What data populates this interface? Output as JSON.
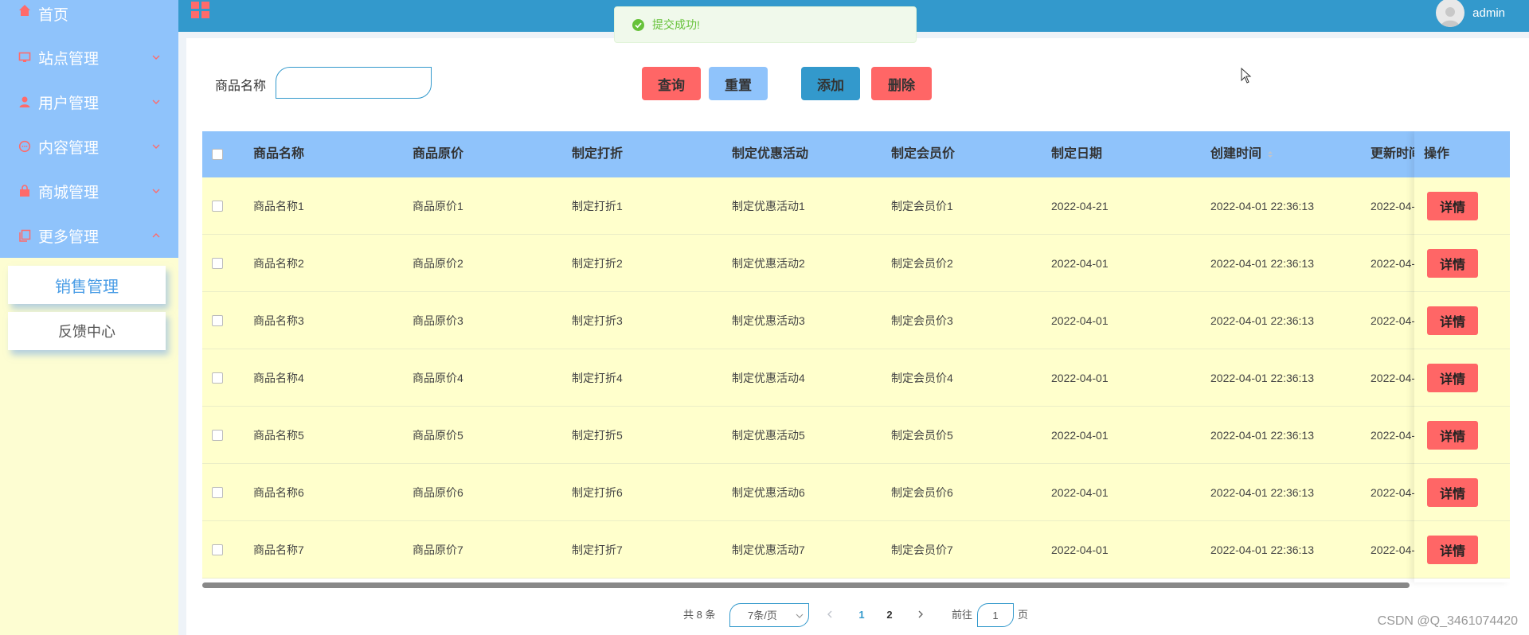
{
  "sidebar": {
    "items": [
      {
        "label": "首页",
        "icon": "home-icon"
      },
      {
        "label": "站点管理",
        "icon": "monitor-icon"
      },
      {
        "label": "用户管理",
        "icon": "user-icon"
      },
      {
        "label": "内容管理",
        "icon": "chat-icon"
      },
      {
        "label": "商城管理",
        "icon": "bag-icon"
      },
      {
        "label": "更多管理",
        "icon": "copy-icon"
      }
    ],
    "submenu": [
      {
        "label": "销售管理"
      },
      {
        "label": "反馈中心"
      }
    ]
  },
  "header": {
    "user_name": "admin"
  },
  "toast": {
    "message": "提交成功!"
  },
  "search": {
    "label": "商品名称",
    "value": "",
    "placeholder": ""
  },
  "toolbar": {
    "query_label": "查询",
    "reset_label": "重置",
    "add_label": "添加",
    "delete_label": "删除"
  },
  "table": {
    "columns": [
      "商品名称",
      "商品原价",
      "制定打折",
      "制定优惠活动",
      "制定会员价",
      "制定日期",
      "创建时间",
      "更新时间",
      "操作"
    ],
    "rows": [
      [
        "商品名称1",
        "商品原价1",
        "制定打折1",
        "制定优惠活动1",
        "制定会员价1",
        "2022-04-21",
        "2022-04-01 22:36:13",
        "2022-04-"
      ],
      [
        "商品名称2",
        "商品原价2",
        "制定打折2",
        "制定优惠活动2",
        "制定会员价2",
        "2022-04-01",
        "2022-04-01 22:36:13",
        "2022-04-"
      ],
      [
        "商品名称3",
        "商品原价3",
        "制定打折3",
        "制定优惠活动3",
        "制定会员价3",
        "2022-04-01",
        "2022-04-01 22:36:13",
        "2022-04-"
      ],
      [
        "商品名称4",
        "商品原价4",
        "制定打折4",
        "制定优惠活动4",
        "制定会员价4",
        "2022-04-01",
        "2022-04-01 22:36:13",
        "2022-04-"
      ],
      [
        "商品名称5",
        "商品原价5",
        "制定打折5",
        "制定优惠活动5",
        "制定会员价5",
        "2022-04-01",
        "2022-04-01 22:36:13",
        "2022-04-"
      ],
      [
        "商品名称6",
        "商品原价6",
        "制定打折6",
        "制定优惠活动6",
        "制定会员价6",
        "2022-04-01",
        "2022-04-01 22:36:13",
        "2022-04-"
      ],
      [
        "商品名称7",
        "商品原价7",
        "制定打折7",
        "制定优惠活动7",
        "制定会员价7",
        "2022-04-01",
        "2022-04-01 22:36:13",
        "2022-04-"
      ]
    ],
    "detail_label": "详情"
  },
  "pagination": {
    "total_text": "共 8 条",
    "page_size": "7条/页",
    "pages": [
      "1",
      "2"
    ],
    "current_page": "1",
    "goto_prefix": "前往",
    "goto_value": "1",
    "goto_suffix": "页"
  },
  "watermark": "CSDN @Q_3461074420",
  "colors": {
    "sidebar_blue": "#8fc3fb",
    "sidebar_yellow": "#fdfdd2",
    "topbar": "#3399cc",
    "row_yellow": "#ffffcc",
    "danger": "#ff6666",
    "success": "#67c23a"
  }
}
